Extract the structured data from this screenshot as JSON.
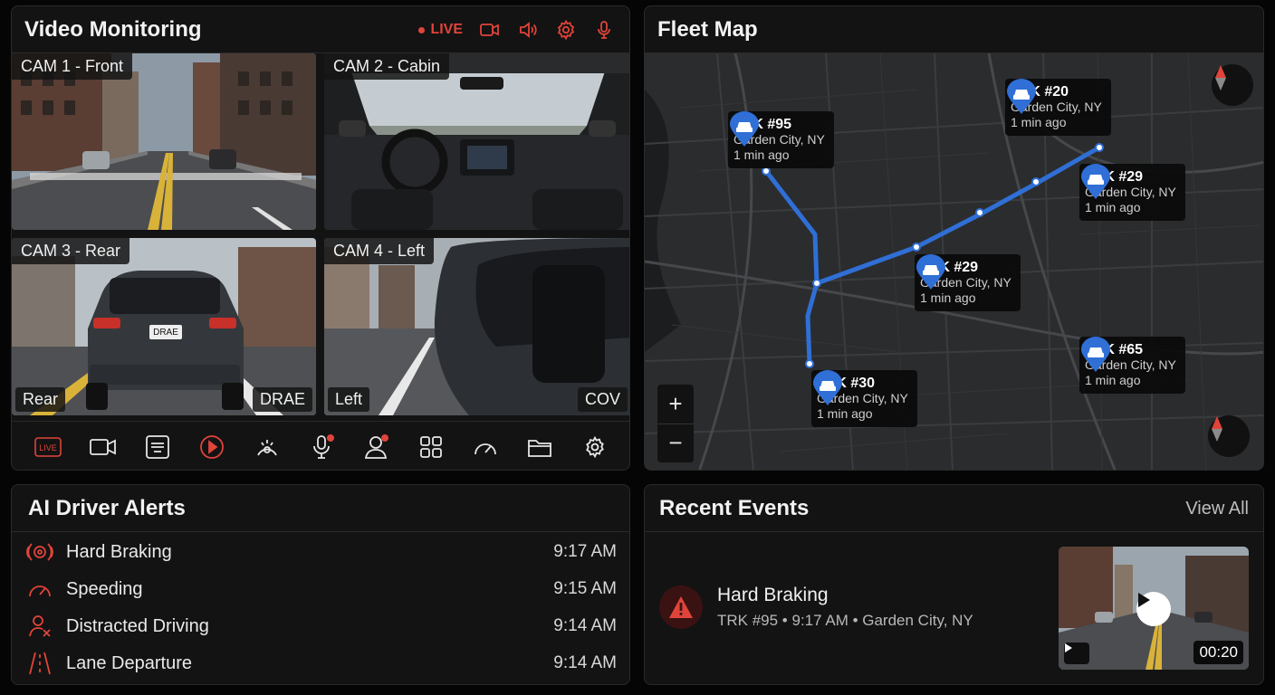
{
  "colors": {
    "accent_red": "#e0443a",
    "map_blue": "#2f6fd6",
    "panel_bg": "#131313"
  },
  "video": {
    "title": "Video Monitoring",
    "live_label": "LIVE",
    "header_icons": [
      "video-camera-icon",
      "speaker-icon",
      "gear-icon",
      "microphone-icon"
    ],
    "cameras": [
      {
        "label": "CAM 1 - Front"
      },
      {
        "label": "CAM 2 - Cabin"
      },
      {
        "label": "CAM 3 - Rear",
        "tag_left": "Rear",
        "tag_right": "DRAE",
        "plate": "DRAE"
      },
      {
        "label": "CAM 4 - Left",
        "tag_left": "Left",
        "tag_right": "COV"
      }
    ],
    "toolbar": {
      "live_label": "LIVE",
      "icons": [
        "live-icon",
        "video-camera-icon",
        "subtitles-icon",
        "play-icon",
        "steering-icon",
        "microphone-icon",
        "driver-alert-icon",
        "grid-icon",
        "speedometer-icon",
        "folder-icon",
        "gear-icon"
      ]
    }
  },
  "map": {
    "title": "Fleet Map",
    "zoom_in": "+",
    "zoom_out": "−",
    "markers": [
      {
        "id": "TRK #95",
        "location": "Garden City, NY",
        "time": "1 min ago"
      },
      {
        "id": "TRK #20",
        "location": "Garden City, NY",
        "time": "1 min ago"
      },
      {
        "id": "TRK #29",
        "location": "Garden City, NY",
        "time": "1 min ago"
      },
      {
        "id": "TRK #29",
        "location": "Garden City, NY",
        "time": "1 min ago"
      },
      {
        "id": "TRK #30",
        "location": "Garden City, NY",
        "time": "1 min ago"
      },
      {
        "id": "TRK #65",
        "location": "Garden City, NY",
        "time": "1 min ago"
      }
    ]
  },
  "alerts": {
    "title": "AI Driver Alerts",
    "items": [
      {
        "label": "Hard Braking",
        "time": "9:17 AM",
        "icon": "hard-braking-icon"
      },
      {
        "label": "Speeding",
        "time": "9:15 AM",
        "icon": "speedometer-icon"
      },
      {
        "label": "Distracted Driving",
        "time": "9:14 AM",
        "icon": "distracted-driver-icon"
      },
      {
        "label": "Lane Departure",
        "time": "9:14 AM",
        "icon": "lane-departure-icon"
      }
    ]
  },
  "events": {
    "title": "Recent Events",
    "view_all": "View All",
    "item": {
      "title": "Hard Braking",
      "subtitle": "TRK #95 • 9:17 AM • Garden City, NY",
      "duration": "00:20"
    }
  }
}
